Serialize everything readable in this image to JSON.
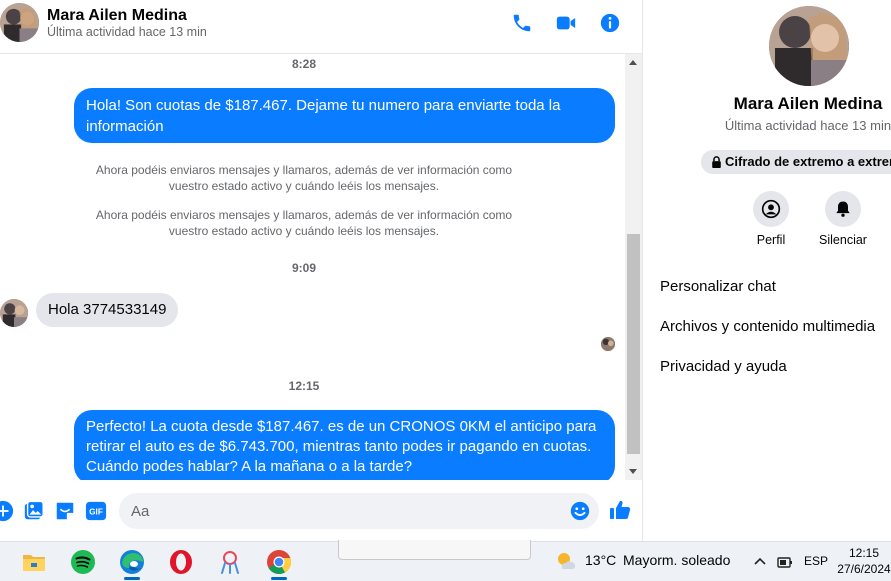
{
  "header": {
    "name": "Mara Ailen Medina",
    "status": "Última actividad hace 13 min"
  },
  "chat": {
    "time1": "8:28",
    "msg_out_1": "Hola! Son cuotas de $187.467. Dejame tu numero para enviarte toda la información",
    "system_1": "Ahora podéis enviaros mensajes y llamaros, además de ver información como vuestro estado activo y cuándo leéis los mensajes.",
    "system_2": "Ahora podéis enviaros mensajes y llamaros, además de ver información como vuestro estado activo y cuándo leéis los mensajes.",
    "time2": "9:09",
    "msg_in_1": "Hola 3774533149",
    "time3": "12:15",
    "msg_out_2": "Perfecto! La cuota desde $187.467. es de un CRONOS 0KM el anticipo para retirar el auto es de $6.743.700, mientras tanto podes ir pagando en cuotas. Cuándo podes hablar? A la mañana o a la tarde?"
  },
  "composer": {
    "placeholder": "Aa"
  },
  "panel": {
    "name": "Mara Ailen Medina",
    "status": "Última actividad hace 13 min",
    "e2e_label": "Cifrado de extremo a extremo",
    "profile_label": "Perfil",
    "mute_label": "Silenciar",
    "items": [
      "Personalizar chat",
      "Archivos y contenido multimedia",
      "Privacidad y ayuda"
    ]
  },
  "taskbar": {
    "temperature": "13°C",
    "condition": "Mayorm. soleado",
    "language": "ESP",
    "time": "12:15",
    "date": "27/6/2024"
  },
  "colors": {
    "accent": "#0a7cff",
    "incoming_bubble": "#e4e6eb",
    "secondary_text": "#65676b"
  },
  "icons": [
    "phone-icon",
    "video-icon",
    "info-icon",
    "plus-icon",
    "image-icon",
    "sticker-icon",
    "gif-icon",
    "emoji-icon",
    "like-icon",
    "lock-icon",
    "profile-icon",
    "bell-icon",
    "file-explorer-icon",
    "spotify-icon",
    "edge-icon",
    "opera-icon",
    "app-icon",
    "chrome-icon",
    "weather-icon",
    "chevron-up-icon",
    "network-icon"
  ]
}
